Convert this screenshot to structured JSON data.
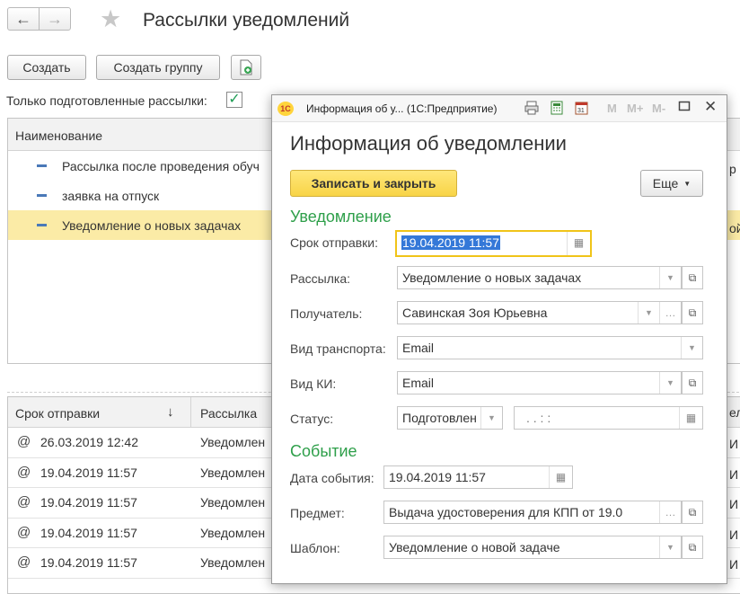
{
  "nav": {
    "back_glyph": "←",
    "forward_glyph": "→"
  },
  "page": {
    "title": "Рассылки уведомлений"
  },
  "toolbar": {
    "create_label": "Создать",
    "create_group_label": "Создать группу",
    "add_icon": "document-add-icon"
  },
  "filter": {
    "label": "Только подготовленные рассылки:",
    "checked": true,
    "check_glyph": "✓"
  },
  "list": {
    "header": "Наименование",
    "items": [
      {
        "label": "Рассылка после проведения обуч"
      },
      {
        "label": "заявка на отпуск"
      },
      {
        "label": "Уведомление о новых задачах",
        "selected": true
      }
    ]
  },
  "notifications": {
    "header_date": "Срок отправки",
    "sort_glyph": "↓",
    "header_mailing": "Рассылка",
    "at_glyph": "@",
    "rows": [
      {
        "date": "26.03.2019 12:42",
        "mailing": "Уведомлен"
      },
      {
        "date": "19.04.2019 11:57",
        "mailing": "Уведомлен"
      },
      {
        "date": "19.04.2019 11:57",
        "mailing": "Уведомлен"
      },
      {
        "date": "19.04.2019 11:57",
        "mailing": "Уведомлен"
      },
      {
        "date": "19.04.2019 11:57",
        "mailing": "Уведомлен"
      }
    ]
  },
  "edge_fragments": {
    "list_p1": "р",
    "list_p2": "ой",
    "hdr_e": "ел",
    "row_i": "И"
  },
  "modal": {
    "window_title": "Информация об у...  (1С:Предприятие)",
    "logo_text": "1С",
    "m_buttons": [
      "M",
      "M+",
      "M-"
    ],
    "title": "Информация об уведомлении",
    "save_close_label": "Записать и закрыть",
    "more_label": "Еще",
    "section_notification": "Уведомление",
    "section_event": "Событие",
    "fields": {
      "send_date_label": "Срок отправки:",
      "send_date_value": "19.04.2019  11:57",
      "mailing_label": "Рассылка:",
      "mailing_value": "Уведомление о новых задачах",
      "recipient_label": "Получатель:",
      "recipient_value": "Савинская Зоя Юрьевна",
      "transport_label": "Вид транспорта:",
      "transport_value": "Email",
      "ci_label": "Вид КИ:",
      "ci_value": "Email",
      "status_label": "Статус:",
      "status_value": "Подготовлен",
      "status_date_value": ".  .       :  :",
      "event_date_label": "Дата события:",
      "event_date_value": "19.04.2019  11:57",
      "subject_label": "Предмет:",
      "subject_value": "Выдача удостоверения для КПП от 19.0",
      "template_label": "Шаблон:",
      "template_value": "Уведомление о новой задаче"
    }
  },
  "colors": {
    "accent_green": "#2e9f4a",
    "highlight": "#fbeba6",
    "primary_button": "#f8d447",
    "selection": "#3478d8"
  }
}
